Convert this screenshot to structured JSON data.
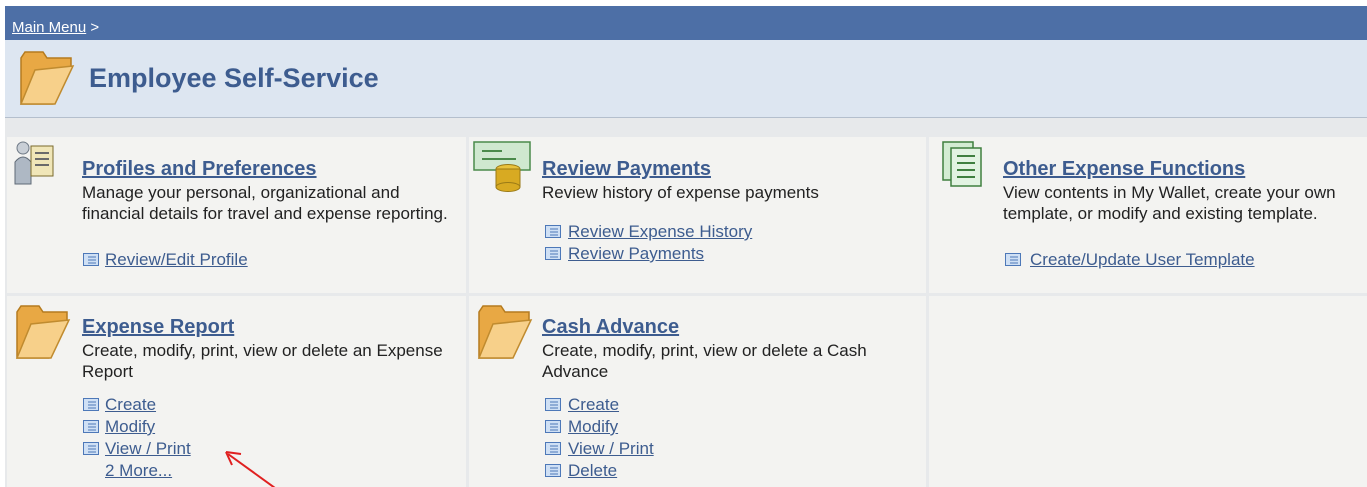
{
  "breadcrumb": {
    "main_menu": "Main Menu",
    "separator": ">"
  },
  "page": {
    "title": "Employee Self-Service"
  },
  "sections": {
    "profiles": {
      "title": "Profiles and Preferences",
      "desc": "Manage your personal, organizational and financial details for travel and expense reporting.",
      "links": [
        "Review/Edit Profile"
      ]
    },
    "review_payments": {
      "title": "Review Payments",
      "desc": "Review history of expense payments",
      "links": [
        "Review Expense History",
        "Review Payments"
      ]
    },
    "other_expense": {
      "title": "Other Expense Functions",
      "desc": "View contents in My Wallet, create your own template, or modify and existing template.",
      "links": [
        "Create/Update User Template"
      ]
    },
    "expense_report": {
      "title": "Expense Report",
      "desc": "Create, modify, print, view or delete an Expense Report",
      "links": [
        "Create",
        "Modify",
        "View / Print"
      ],
      "more": "2 More..."
    },
    "cash_advance": {
      "title": "Cash Advance",
      "desc": "Create, modify, print, view or delete a Cash Advance",
      "links": [
        "Create",
        "Modify",
        "View / Print",
        "Delete"
      ]
    }
  },
  "colors": {
    "header_bar": "#4d6fa6",
    "title_band": "#dde6f1",
    "link": "#3d5c8f",
    "annotation_arrow": "#e02020"
  },
  "icons": {
    "page": "folder-icon",
    "profiles": "person-document-icon",
    "review_payments": "check-coins-icon",
    "other_expense": "documents-icon",
    "expense_report": "folder-icon",
    "cash_advance": "folder-icon"
  }
}
